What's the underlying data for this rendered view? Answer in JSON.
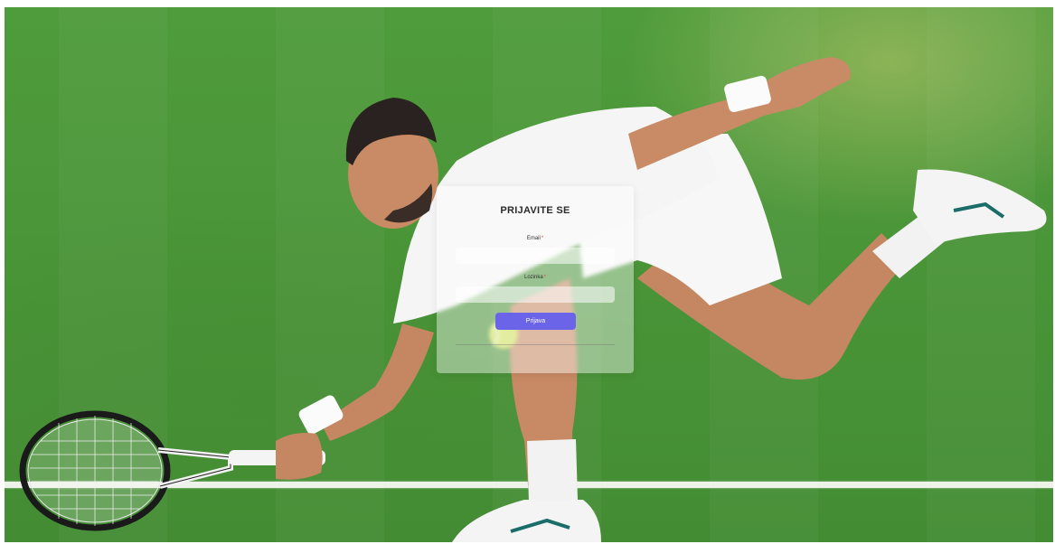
{
  "login": {
    "title": "PRIJAVITE SE",
    "email_label": "Email",
    "password_label": "Lozinka",
    "required_mark": "*",
    "email_value": "",
    "password_value": "",
    "submit_label": "Prijava"
  },
  "colors": {
    "button": "#6b63e8",
    "required": "#dd4444",
    "grass": "#4a9538"
  },
  "icons": {
    "background": "tennis-player-photo"
  }
}
